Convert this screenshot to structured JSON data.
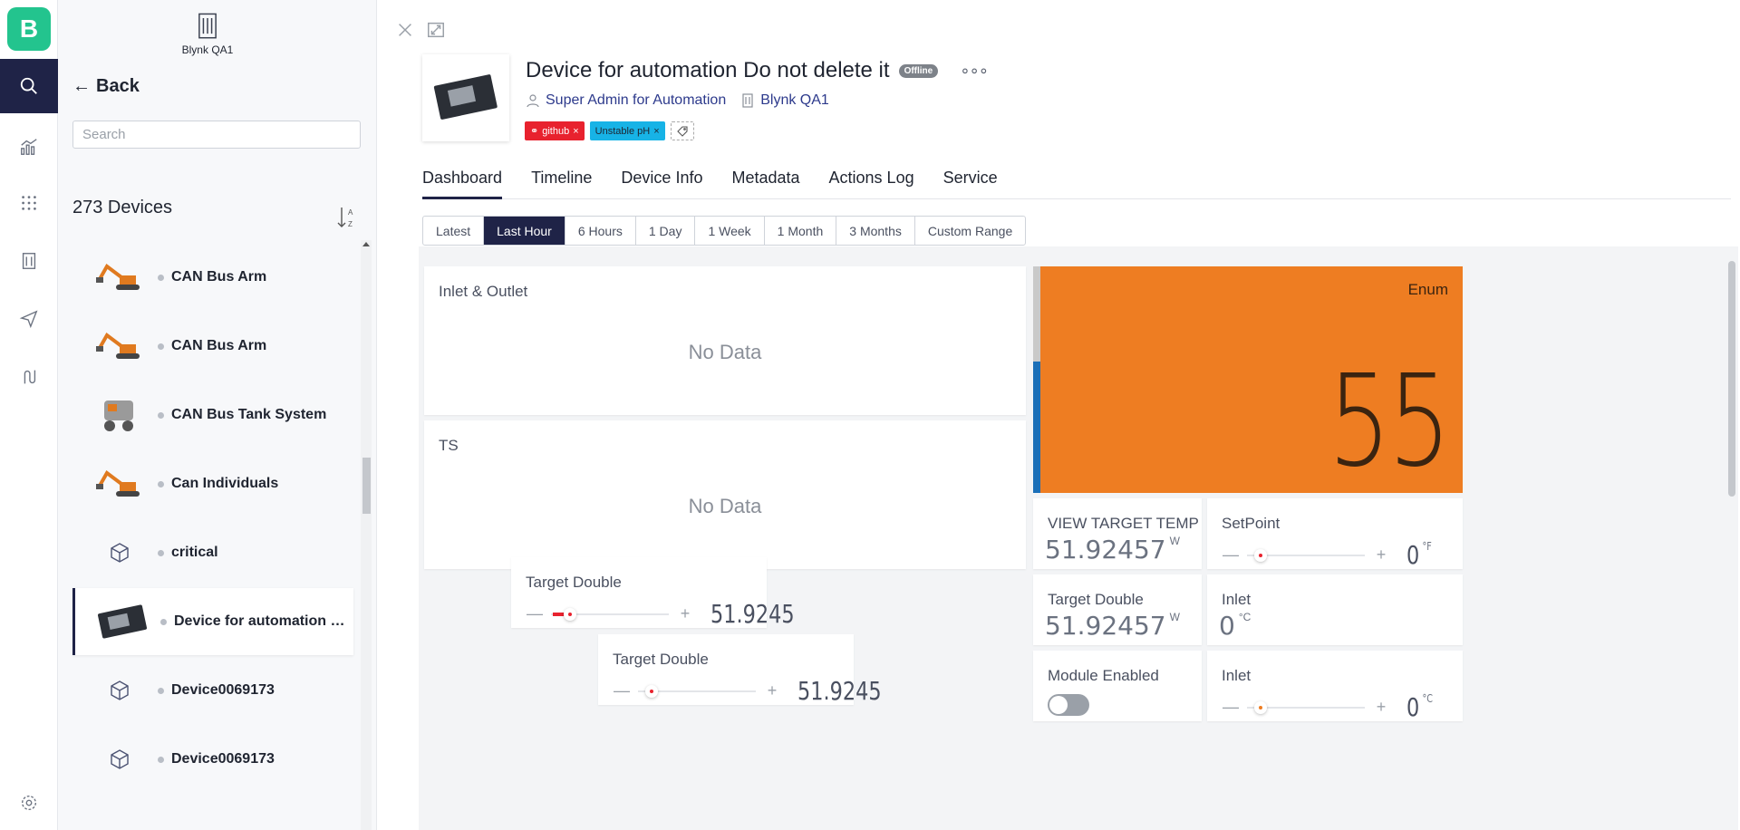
{
  "org": {
    "name": "Blynk QA1"
  },
  "logo_letter": "B",
  "rail": {
    "icons": [
      "search-icon",
      "analytics-icon",
      "grid-icon",
      "building-icon",
      "send-icon",
      "route-icon",
      "settings-icon"
    ]
  },
  "list": {
    "back_label": "Back",
    "search_placeholder": "Search",
    "device_count": "273 Devices",
    "items": [
      {
        "name": "CAN Bus Arm",
        "thumb": "excavator"
      },
      {
        "name": "CAN Bus Arm",
        "thumb": "excavator"
      },
      {
        "name": "CAN Bus Tank System",
        "thumb": "tank"
      },
      {
        "name": "Can Individuals",
        "thumb": "excavator"
      },
      {
        "name": "critical",
        "thumb": "cube"
      },
      {
        "name": "Device for automation Do...",
        "thumb": "board"
      },
      {
        "name": "Device0069173",
        "thumb": "cube"
      },
      {
        "name": "Device0069173",
        "thumb": "cube"
      }
    ]
  },
  "device": {
    "title": "Device for automation Do not delete it",
    "status": "Offline",
    "owner": "Super Admin for Automation",
    "org": "Blynk QA1",
    "tags": [
      {
        "label": "github",
        "color": "#e8222e"
      },
      {
        "label": "Unstable pH",
        "color": "#17b3e6"
      }
    ]
  },
  "tabs": [
    "Dashboard",
    "Timeline",
    "Device Info",
    "Metadata",
    "Actions Log",
    "Service"
  ],
  "active_tab": "Dashboard",
  "ranges": [
    "Latest",
    "Last Hour",
    "6 Hours",
    "1 Day",
    "1 Week",
    "1 Month",
    "3 Months",
    "Custom Range"
  ],
  "active_range": "Last Hour",
  "widgets": {
    "inlet_outlet": {
      "title": "Inlet & Outlet",
      "empty": "No Data"
    },
    "ts": {
      "title": "TS",
      "empty": "No Data"
    },
    "enum": {
      "label": "Enum",
      "value": "55",
      "level": 0.58
    },
    "view_target_temp": {
      "title": "VIEW TARGET TEMP",
      "value": "51.92457",
      "unit": "W"
    },
    "setpoint": {
      "title": "SetPoint",
      "value": "0",
      "unit": "°F",
      "level": 0.1
    },
    "target_double_a": {
      "title": "Target Double",
      "value": "51.9245",
      "level": 0.12
    },
    "target_double_b": {
      "title": "Target Double",
      "value": "51.92457",
      "unit": "W"
    },
    "inlet_a": {
      "title": "Inlet",
      "value": "0",
      "unit": "°C"
    },
    "target_double_c": {
      "title": "Target Double",
      "value": "51.9245",
      "level": 0.12
    },
    "module_enabled": {
      "title": "Module Enabled",
      "state": false
    },
    "inlet_b": {
      "title": "Inlet",
      "value": "0",
      "unit": "°C",
      "level": 0.1
    }
  }
}
